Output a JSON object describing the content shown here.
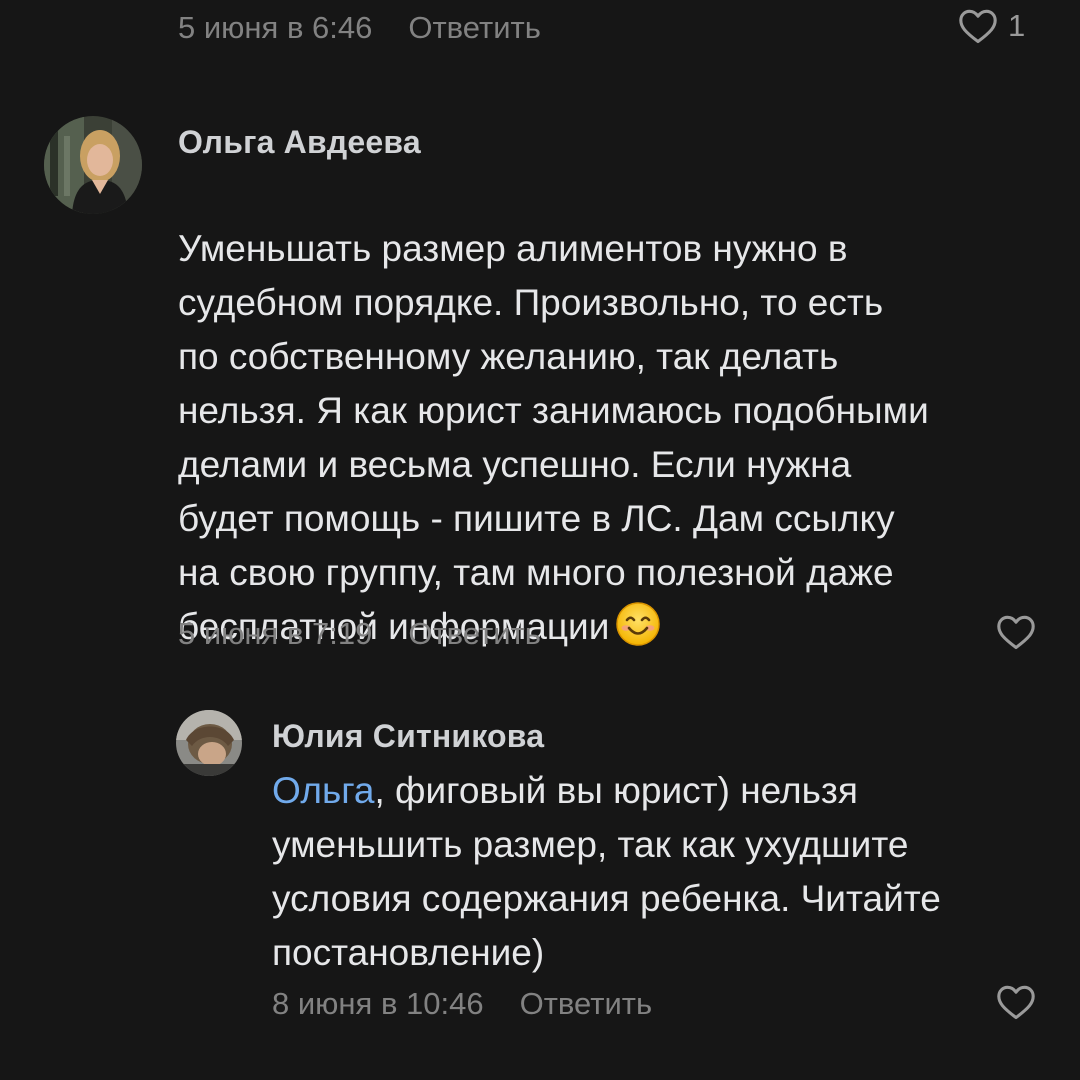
{
  "top_comment": {
    "date": "5 июня в 6:46",
    "reply_label": "Ответить",
    "likes": "1"
  },
  "comment_1": {
    "author": "Ольга Авдеева",
    "text": "Уменьшать размер алиментов нужно в\nсудебном порядке. Произвольно, то есть\nпо собственному желанию, так делать\nнельзя. Я как юрист занимаюсь подобными\nделами и весьма успешно. Если нужна\nбудет помощь - пишите в ЛС. Дам ссылку\nна свою группу, там много полезной даже\nбесплатной информации",
    "emoji": "smiling-face-emoji",
    "date": "5 июня в 7:19",
    "reply_label": "Ответить"
  },
  "comment_2": {
    "author": "Юлия Ситникова",
    "mention": "Ольга",
    "text": ", фиговый вы юрист) нельзя\nуменьшить размер, так как ухудшите\nусловия содержания ребенка. Читайте\nпостановление)",
    "date": "8 июня в 10:46",
    "reply_label": "Ответить"
  },
  "colors": {
    "background": "#161616",
    "text": "#e6e7e9",
    "secondary": "#828282",
    "link": "#71aaeb"
  }
}
